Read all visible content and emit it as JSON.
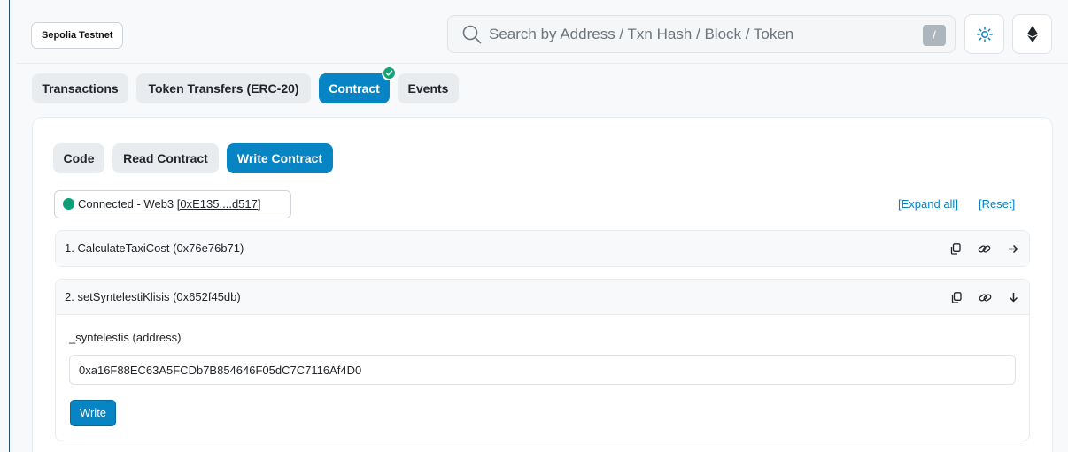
{
  "header": {
    "network": "Sepolia Testnet",
    "search_placeholder": "Search by Address / Txn Hash / Block / Token",
    "search_shortcut": "/",
    "theme_icon": "sun-icon",
    "chain_icon": "ethereum-icon"
  },
  "tabs": [
    {
      "label": "Transactions",
      "active": false
    },
    {
      "label": "Token Transfers (ERC-20)",
      "active": false
    },
    {
      "label": "Contract",
      "active": true,
      "verified": true
    },
    {
      "label": "Events",
      "active": false
    }
  ],
  "subtabs": [
    {
      "label": "Code",
      "active": false
    },
    {
      "label": "Read Contract",
      "active": false
    },
    {
      "label": "Write Contract",
      "active": true
    }
  ],
  "connection": {
    "status": "Connected - Web3",
    "address": "[0xE135....d517]",
    "dot_color": "#0a9f76"
  },
  "actions": {
    "expand_all": "[Expand all]",
    "reset": "[Reset]"
  },
  "functions": [
    {
      "label": "1. CalculateTaxiCost (0x76e76b71)",
      "expanded": false
    },
    {
      "label": "2. setSyntelestiKlisis (0x652f45db)",
      "expanded": true
    }
  ],
  "param": {
    "label": "_syntelestis (address)",
    "value": "0xa16F88EC63A5FCDb7B854646F05dC7C7116Af4D0"
  },
  "write_label": "Write",
  "colors": {
    "accent": "#0784c3",
    "success": "#14a479"
  }
}
